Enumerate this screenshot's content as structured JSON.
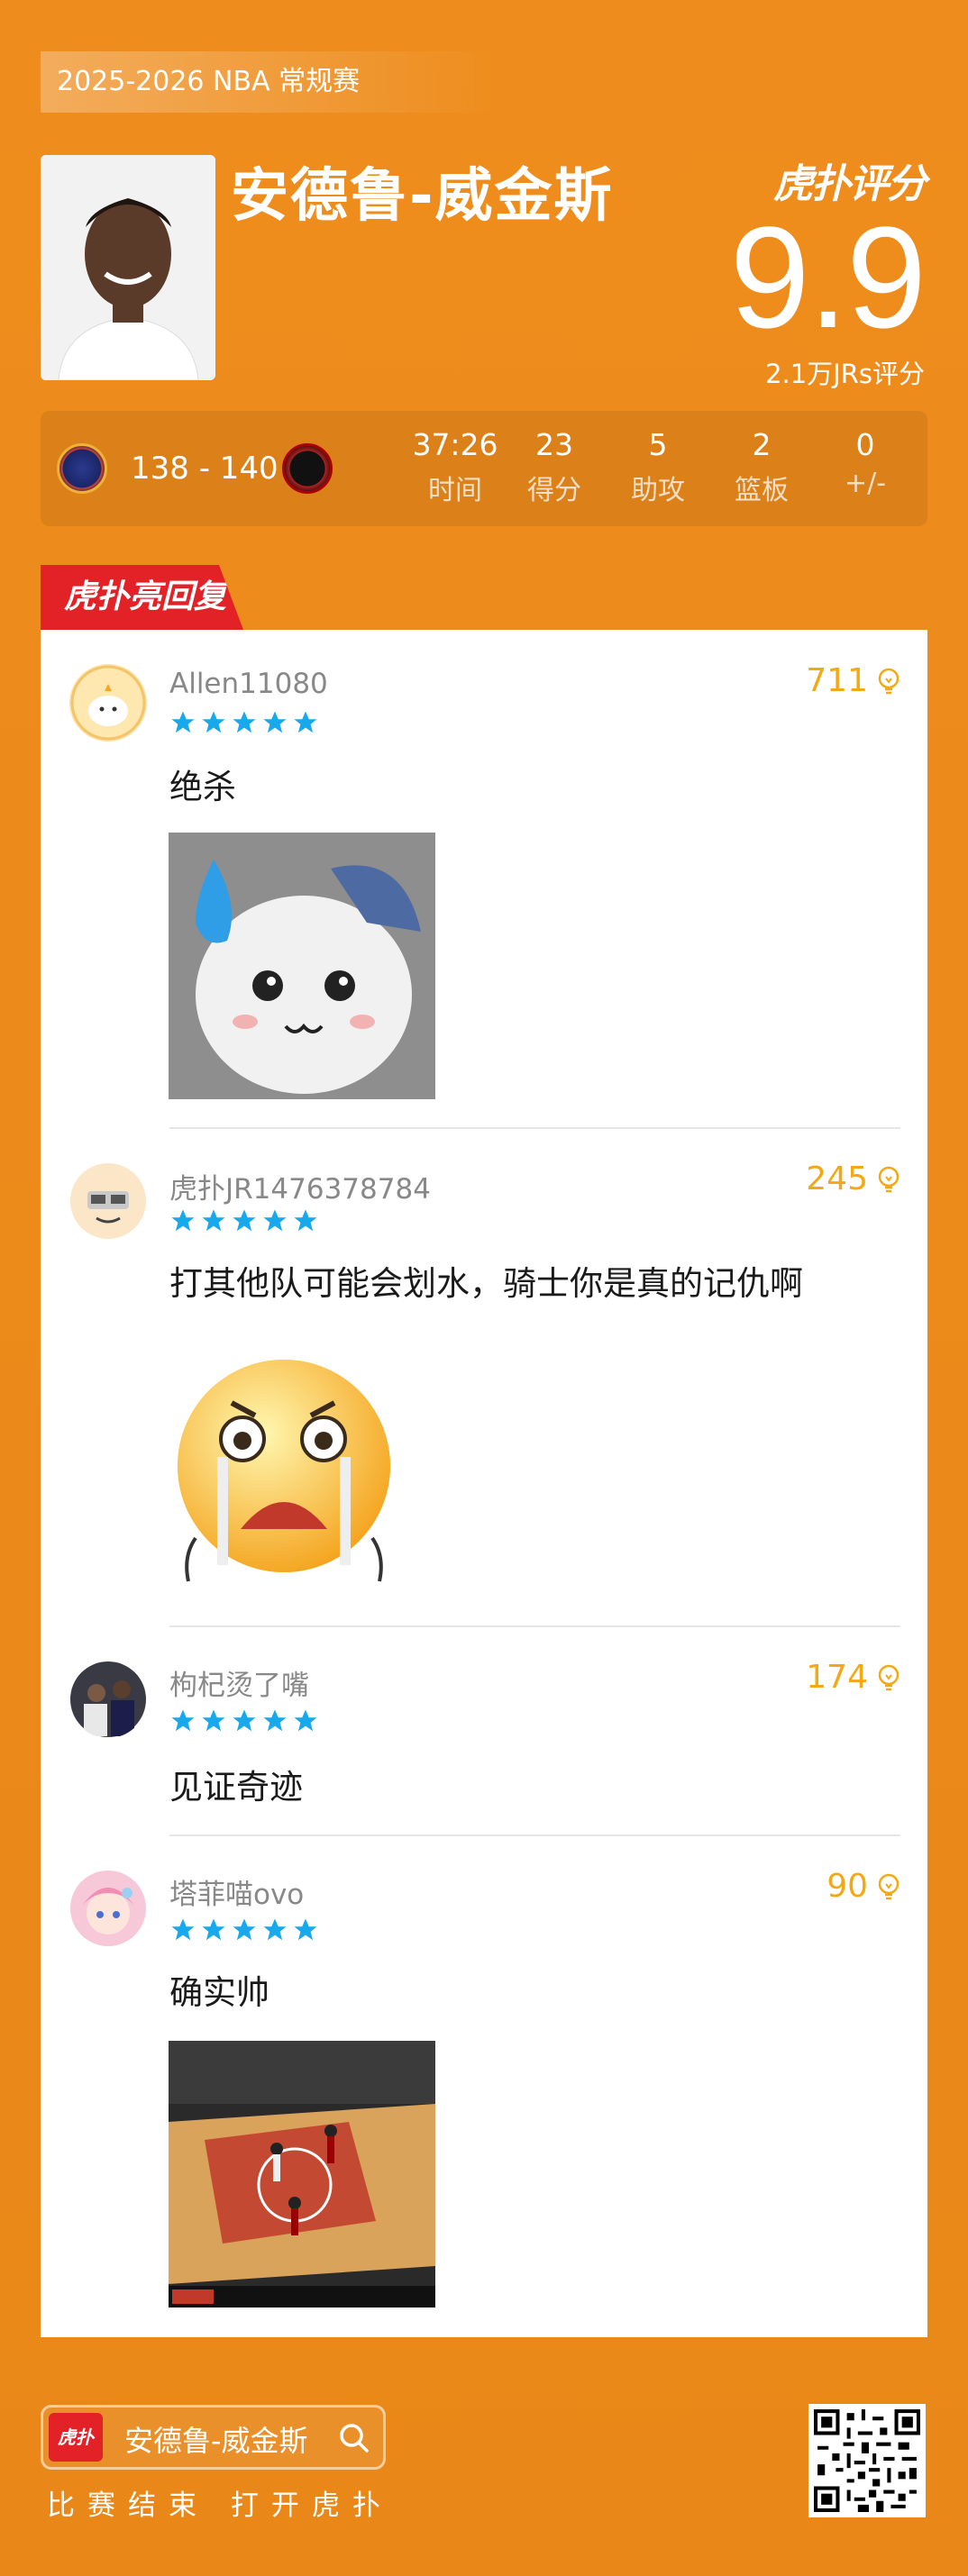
{
  "header": {
    "season": "2025-2026 NBA 常规赛",
    "player_name": "安德鲁-威金斯",
    "brand": "虎扑评分",
    "rating": "9.9",
    "votes": "2.1万JRs评分"
  },
  "game": {
    "score": "138 - 140",
    "stats": [
      {
        "value": "37:26",
        "label": "时间"
      },
      {
        "value": "23",
        "label": "得分"
      },
      {
        "value": "5",
        "label": "助攻"
      },
      {
        "value": "2",
        "label": "篮板"
      },
      {
        "value": "0",
        "label": "+/-"
      }
    ]
  },
  "section_tag": "虎扑亮回复",
  "comments": [
    {
      "user": "Allen11080",
      "likes": "711",
      "text": "绝杀",
      "stars": 5
    },
    {
      "user": "虎扑JR1476378784",
      "likes": "245",
      "text": "打其他队可能会划水，骑士你是真的记仇啊",
      "stars": 5
    },
    {
      "user": "枸杞烫了嘴",
      "likes": "174",
      "text": "见证奇迹",
      "stars": 5
    },
    {
      "user": "塔菲喵ovo",
      "likes": "90",
      "text": "确实帅",
      "stars": 5
    }
  ],
  "footer": {
    "logo_text": "虎扑",
    "search_name": "安德鲁-威金斯",
    "tip": "比赛结束 打开虎扑"
  },
  "colors": {
    "background": "#ec8a1b",
    "accent_red": "#e32227",
    "like_gold": "#f3a915",
    "star_blue": "#17a9ec"
  }
}
